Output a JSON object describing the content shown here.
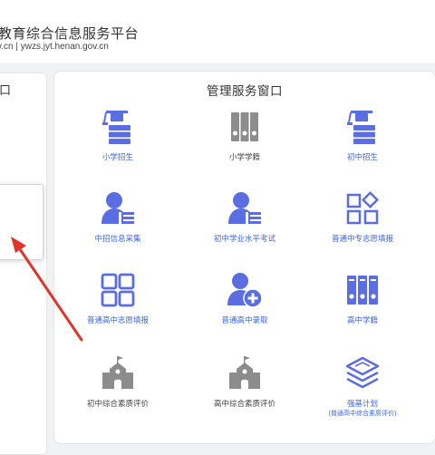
{
  "header": {
    "title": "教育综合信息服务平台",
    "url": "v.cn | ywzs.jyt.henan.gov.cn"
  },
  "left_panel": {
    "title": "口"
  },
  "main_panel": {
    "title": "管理服务窗口",
    "tiles": [
      {
        "label": "小学招生",
        "icon": "graduation-books-icon",
        "color": "#5b6ee1"
      },
      {
        "label": "小学学籍",
        "icon": "binders-icon",
        "color": "#8c8c8c"
      },
      {
        "label": "初中招生",
        "icon": "graduation-books-icon",
        "color": "#5b6ee1"
      },
      {
        "label": "中招信息采集",
        "icon": "user-list-icon",
        "color": "#5b6ee1"
      },
      {
        "label": "初中学业水平考试",
        "icon": "user-list-icon",
        "color": "#5b6ee1"
      },
      {
        "label": "普通中专志愿填报",
        "icon": "shapes-grid-icon",
        "color": "#5b6ee1"
      },
      {
        "label": "普通高中志愿填报",
        "icon": "grid-icon",
        "color": "#5b6ee1"
      },
      {
        "label": "普通高中录取",
        "icon": "user-add-icon",
        "color": "#5b6ee1"
      },
      {
        "label": "高中学籍",
        "icon": "binders-icon",
        "color": "#5b6ee1"
      },
      {
        "label": "初中综合素质评价",
        "icon": "school-building-icon",
        "color": "#8c8c8c"
      },
      {
        "label": "高中综合素质评价",
        "icon": "school-building-icon",
        "color": "#8c8c8c"
      },
      {
        "label": "强基计划",
        "sublabel": "(普通高中综合素质评价)",
        "icon": "layers-icon",
        "color": "#5b6ee1"
      }
    ]
  },
  "colors": {
    "accent": "#5b6ee1",
    "link": "#3d66e0",
    "arrow": "#e0352b",
    "disabled": "#8c8c8c"
  }
}
